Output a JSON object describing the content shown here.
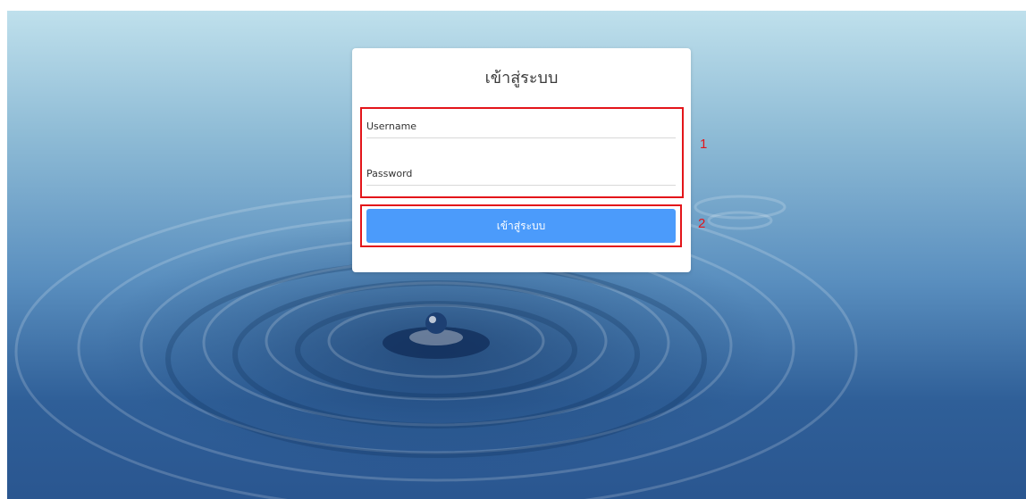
{
  "login": {
    "title": "เข้าสู่ระบบ",
    "username_placeholder": "Username",
    "password_placeholder": "Password",
    "submit_label": "เข้าสู่ระบบ"
  },
  "annotations": {
    "box1_label": "1",
    "box2_label": "2",
    "color": "#e3151a"
  },
  "colors": {
    "button": "#4b9bfb",
    "card": "#ffffff"
  },
  "background": {
    "image": "water-drop-ripples"
  }
}
